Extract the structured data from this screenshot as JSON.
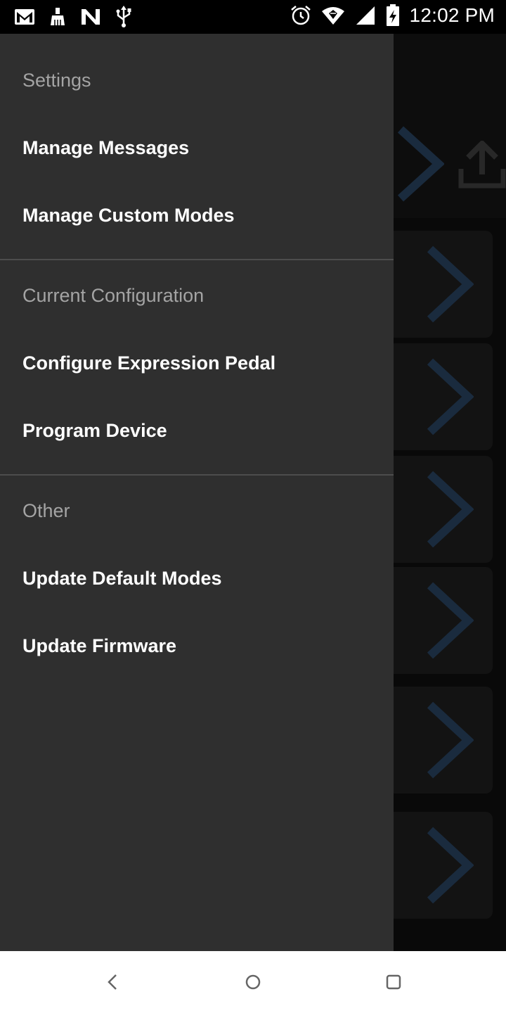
{
  "status_bar": {
    "time": "12:02 PM",
    "left_icons": [
      "gmail-icon",
      "cleaner-icon",
      "n-app-icon",
      "usb-icon"
    ],
    "right_icons": [
      "alarm-icon",
      "wifi-icon",
      "signal-icon",
      "battery-charging-icon"
    ]
  },
  "drawer": {
    "sections": [
      {
        "header": "Settings",
        "items": [
          "Manage Messages",
          "Manage Custom Modes"
        ]
      },
      {
        "header": "Current Configuration",
        "items": [
          "Configure Expression Pedal",
          "Program Device"
        ]
      },
      {
        "header": "Other",
        "items": [
          "Update Default Modes",
          "Update Firmware"
        ]
      }
    ]
  },
  "background_app": {
    "toolbar_icons": [
      "chevron-right-icon",
      "upload-icon"
    ],
    "card_count": 6
  },
  "nav_bar": {
    "buttons": [
      "back-button",
      "home-button",
      "recents-button"
    ]
  },
  "colors": {
    "drawer_bg": "#2f2f2f",
    "section_header": "#a4a4a4",
    "item_text": "#ffffff",
    "accent_chevron": "#3a5f8a"
  }
}
